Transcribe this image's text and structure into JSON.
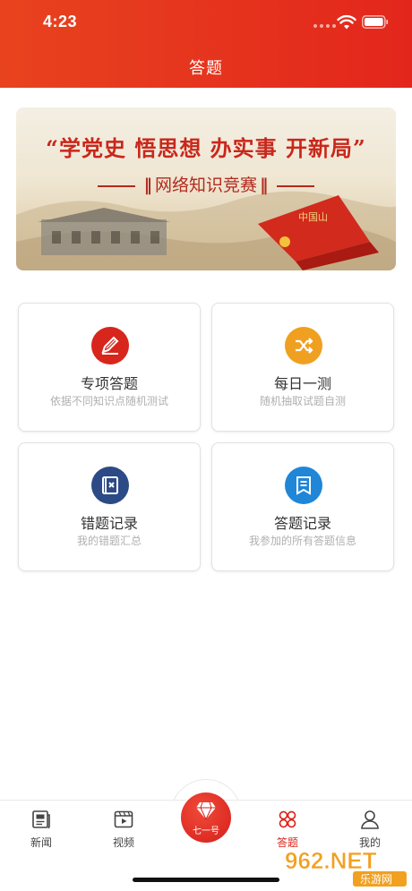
{
  "status_bar": {
    "time": "4:23"
  },
  "header": {
    "title": "答题"
  },
  "banner": {
    "headline": "“学党史  悟思想  办实事  开新局”",
    "subtitle": "网络知识竞赛",
    "flag_text": "中国山"
  },
  "cards": [
    {
      "title": "专项答题",
      "desc": "依据不同知识点随机测试",
      "icon": "pencil-icon",
      "color": "#d8261c"
    },
    {
      "title": "每日一测",
      "desc": "随机抽取试题自测",
      "icon": "shuffle-icon",
      "color": "#f0a020"
    },
    {
      "title": "错题记录",
      "desc": "我的错题汇总",
      "icon": "wrong-book-icon",
      "color": "#2c4a86"
    },
    {
      "title": "答题记录",
      "desc": "我参加的所有答题信息",
      "icon": "record-icon",
      "color": "#1f86d8"
    }
  ],
  "tabbar": {
    "items": [
      {
        "label": "新闻",
        "icon": "newspaper-icon"
      },
      {
        "label": "视频",
        "icon": "video-icon"
      },
      {
        "label": "七一号",
        "icon": "diamond-icon"
      },
      {
        "label": "答题",
        "icon": "quiz-icon",
        "active": true
      },
      {
        "label": "我的",
        "icon": "user-icon"
      }
    ]
  },
  "watermark": {
    "brand": "962.NET",
    "sub": "乐游网"
  },
  "colors": {
    "primary": "#e3261c",
    "accent": "#d8261c"
  }
}
